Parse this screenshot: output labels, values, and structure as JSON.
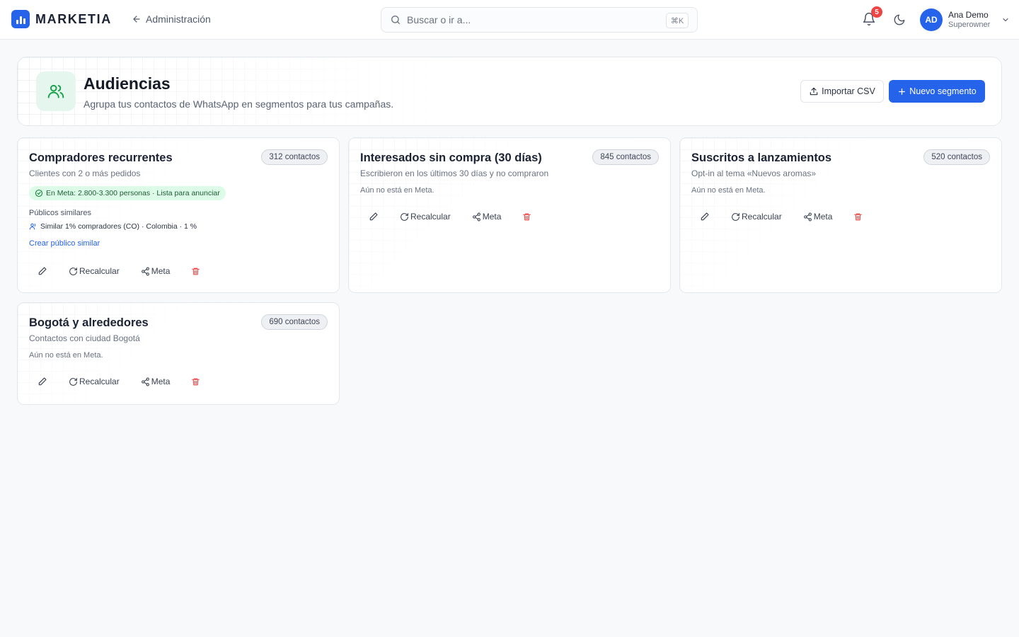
{
  "app": {
    "brand": "MARKETIA",
    "back_label": "Administración",
    "search_placeholder": "Buscar o ir a...",
    "search_shortcut": "⌘K",
    "notifications_count": "5",
    "user": {
      "initials": "AD",
      "name": "Ana Demo",
      "role": "Superowner"
    },
    "colors": {
      "primary": "#2563eb",
      "success_bg": "#dcfce7",
      "danger": "#ef4444"
    }
  },
  "header": {
    "title": "Audiencias",
    "subtitle": "Agrupa tus contactos de WhatsApp en segmentos para tus campañas.",
    "import_label": "Importar CSV",
    "new_label": "Nuevo segmento",
    "icon": "users-icon"
  },
  "segments": [
    {
      "name": "Compradores recurrentes",
      "count": "312 contactos",
      "description": "Clientes con 2 o más pedidos",
      "meta_status": "En Meta: 2.800-3.300 personas · Lista para anunciar",
      "lookalikes_heading": "Públicos similares",
      "lookalike": "Similar 1% compradores (CO) · Colombia · 1 %",
      "create_lookalike": "Crear público similar"
    },
    {
      "name": "Interesados sin compra (30 días)",
      "count": "845 contactos",
      "description": "Escribieron en los últimos 30 días y no compraron",
      "meta_status": "Aún no está en Meta."
    },
    {
      "name": "Suscritos a lanzamientos",
      "count": "520 contactos",
      "description": "Opt-in al tema «Nuevos aromas»",
      "meta_status": "Aún no está en Meta."
    },
    {
      "name": "Bogotá y alrededores",
      "count": "690 contactos",
      "description": "Contactos con ciudad Bogotá",
      "meta_status": "Aún no está en Meta."
    }
  ],
  "actions": {
    "recalc_label": "Recalcular",
    "meta_label": "Meta"
  }
}
